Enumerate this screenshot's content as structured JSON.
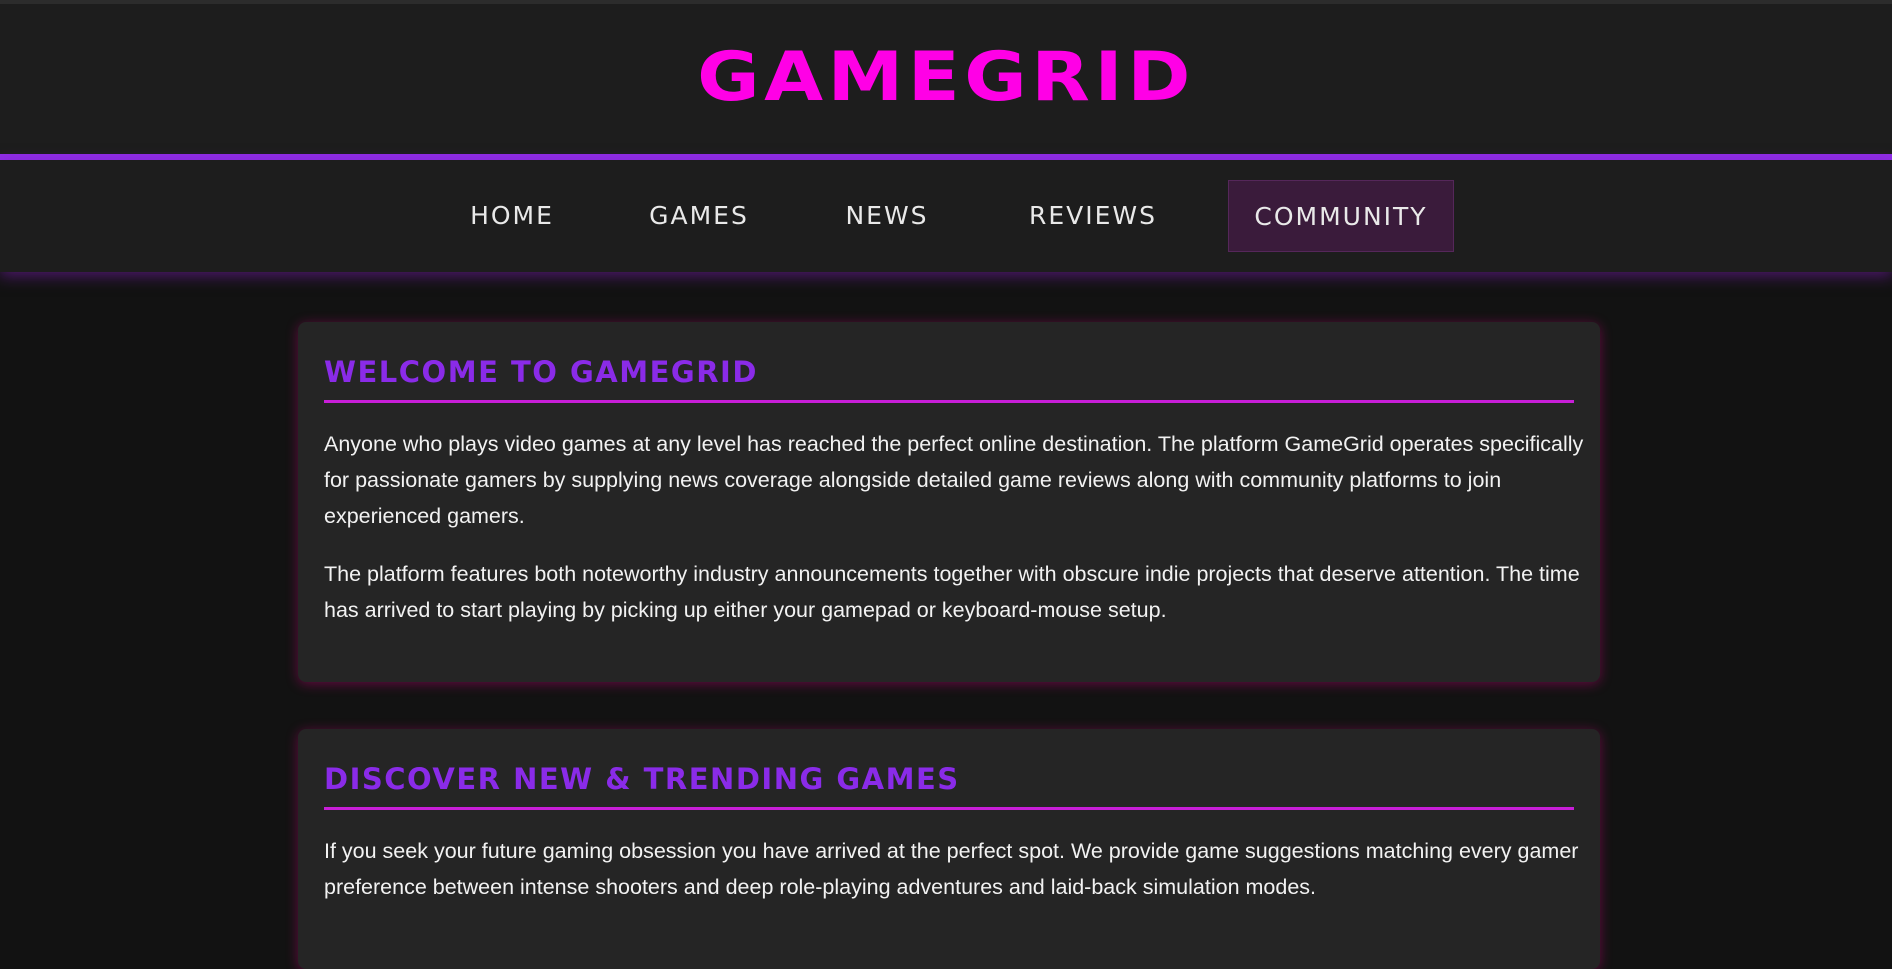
{
  "site": {
    "logo": "GAMEGRID"
  },
  "nav": {
    "items": [
      {
        "label": "HOME"
      },
      {
        "label": "GAMES"
      },
      {
        "label": "NEWS"
      },
      {
        "label": "REVIEWS"
      },
      {
        "label": "COMMUNITY",
        "active": true
      }
    ]
  },
  "sections": [
    {
      "title": "WELCOME TO GAMEGRID",
      "paragraphs": [
        "Anyone who plays video games at any level has reached the perfect online destination. The platform GameGrid operates specifically for passionate gamers by supplying news coverage alongside detailed game reviews along with community platforms to join experienced gamers.",
        "The platform features both noteworthy industry announcements together with obscure indie projects that deserve attention. The time has arrived to start playing by picking up either your gamepad or keyboard-mouse setup."
      ]
    },
    {
      "title": "DISCOVER NEW & TRENDING GAMES",
      "paragraphs": [
        "If you seek your future gaming obsession you have arrived at the perfect spot. We provide game suggestions matching every gamer preference between intense shooters and deep role-playing adventures and laid-back simulation modes."
      ]
    }
  ],
  "colors": {
    "brand_magenta": "#ff00e6",
    "accent_purple": "#8f2de6",
    "heading_purple": "#8a2be8",
    "active_nav_bg": "#3a1b3b"
  }
}
